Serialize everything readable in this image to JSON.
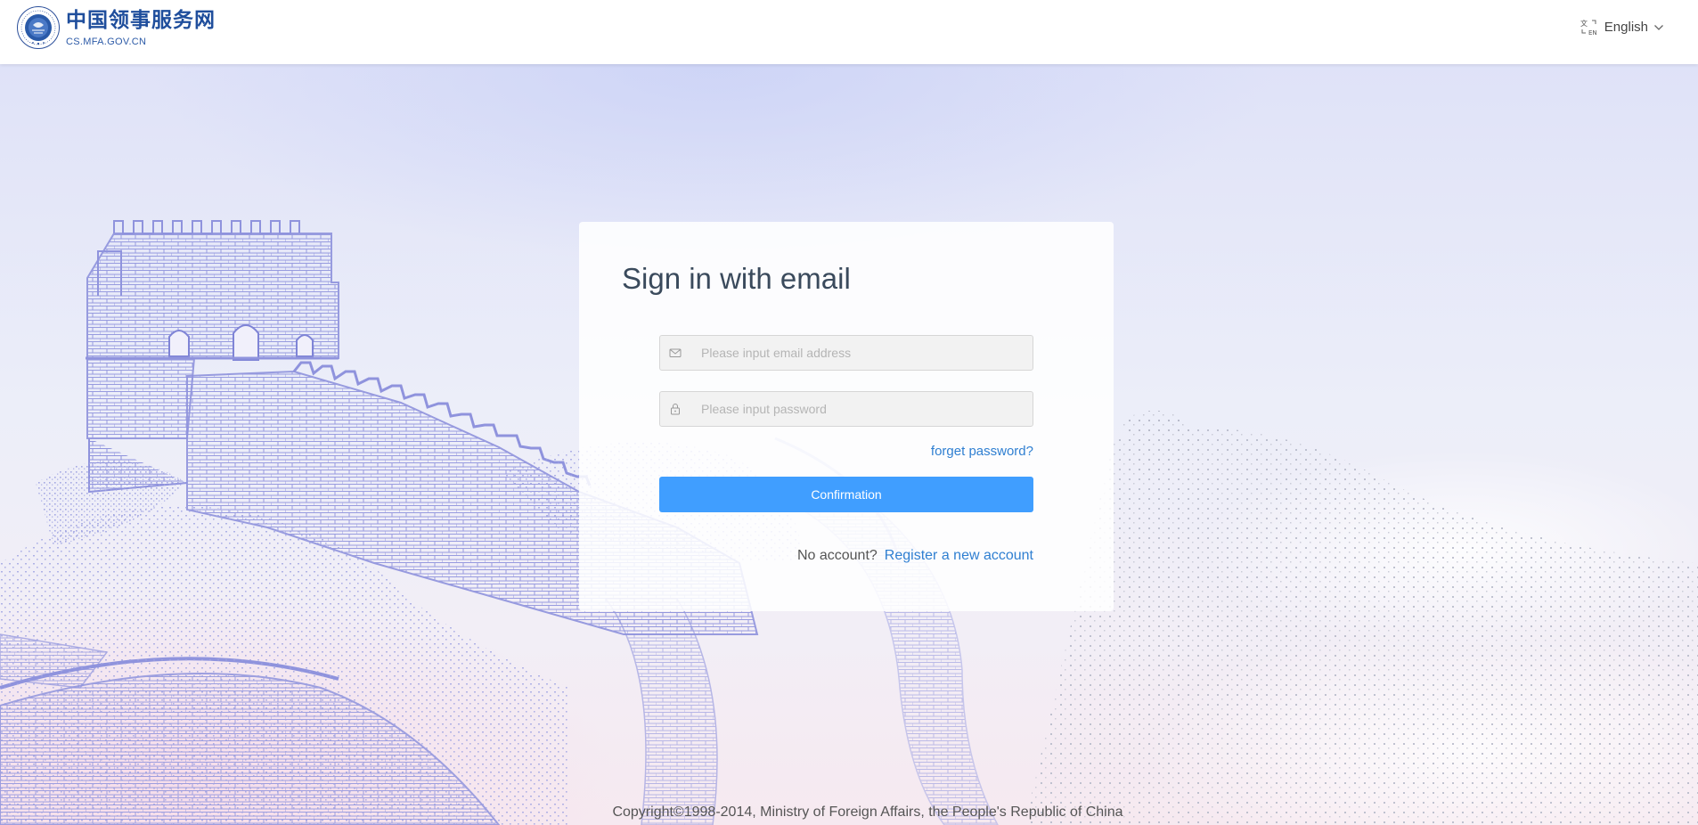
{
  "header": {
    "site_name_cn": "中国领事服务网",
    "site_domain": "CS.MFA.GOV.CN",
    "seal_icon": "consular-seal-logo",
    "language": {
      "label": "English",
      "icon": "translate-icon",
      "chevron": "chevron-down-icon"
    }
  },
  "login": {
    "title": "Sign in with email",
    "email_placeholder": "Please input email address",
    "email_value": "",
    "email_icon": "mail-icon",
    "password_placeholder": "Please input password",
    "password_value": "",
    "password_icon": "lock-icon",
    "forget_password": "forget password?",
    "confirm_label": "Confirmation",
    "no_account": "No account?",
    "register_link": "Register a new account"
  },
  "footer": {
    "copyright": "Copyright©1998-2014, Ministry of Foreign Affairs, the People's Republic of China"
  },
  "colors": {
    "primary_button": "#409eff",
    "link": "#2f7fd1",
    "brand_blue": "#1f4e9c",
    "wall_sketch": "#8f93dd"
  }
}
